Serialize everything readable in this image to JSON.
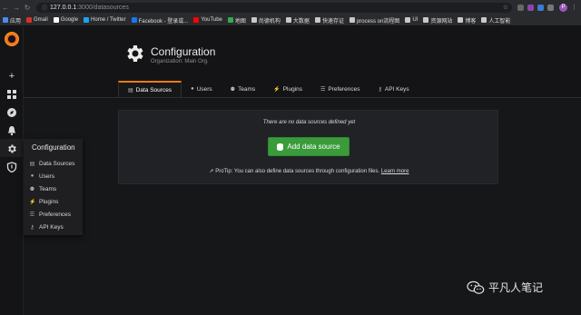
{
  "browser": {
    "url_host": "127.0.0.1",
    "url_path": ":3000/datasources",
    "profile_initial": "P",
    "bookmarks": [
      {
        "label": "应用",
        "color": "#4c8bf5"
      },
      {
        "label": "Gmail",
        "color": "#d93025"
      },
      {
        "label": "Google",
        "color": "#ffffff"
      },
      {
        "label": "Home / Twitter",
        "color": "#1da1f2"
      },
      {
        "label": "Facebook - 登录或...",
        "color": "#1877f2"
      },
      {
        "label": "YouTube",
        "color": "#ff0000"
      },
      {
        "label": "地图",
        "color": "#34a853"
      },
      {
        "label": "尚德机构",
        "color": "#c8c8c8"
      },
      {
        "label": "大数据",
        "color": "#c8c8c8"
      },
      {
        "label": "快速存证",
        "color": "#c8c8c8"
      },
      {
        "label": "process on流程图",
        "color": "#c8c8c8"
      },
      {
        "label": "UI",
        "color": "#c8c8c8"
      },
      {
        "label": "资源网站",
        "color": "#c8c8c8"
      },
      {
        "label": "博客",
        "color": "#c8c8c8"
      },
      {
        "label": "人工智能",
        "color": "#c8c8c8"
      }
    ]
  },
  "sidebar": {
    "icons": [
      "plus-icon",
      "dashboards-icon",
      "explore-icon",
      "alerting-icon",
      "configuration-icon",
      "shield-icon"
    ]
  },
  "flyout": {
    "title": "Configuration",
    "items": [
      {
        "label": "Data Sources",
        "icon": "database-icon"
      },
      {
        "label": "Users",
        "icon": "user-icon"
      },
      {
        "label": "Teams",
        "icon": "users-icon"
      },
      {
        "label": "Plugins",
        "icon": "plug-icon"
      },
      {
        "label": "Preferences",
        "icon": "sliders-icon"
      },
      {
        "label": "API Keys",
        "icon": "key-icon"
      }
    ]
  },
  "header": {
    "title": "Configuration",
    "subtitle": "Organization: Main Org."
  },
  "tabs": [
    {
      "label": "Data Sources",
      "icon": "database-icon",
      "active": true
    },
    {
      "label": "Users",
      "icon": "user-icon",
      "active": false
    },
    {
      "label": "Teams",
      "icon": "users-icon",
      "active": false
    },
    {
      "label": "Plugins",
      "icon": "plug-icon",
      "active": false
    },
    {
      "label": "Preferences",
      "icon": "sliders-icon",
      "active": false
    },
    {
      "label": "API Keys",
      "icon": "key-icon",
      "active": false
    }
  ],
  "empty": {
    "message": "There are no data sources defined yet",
    "button_label": "Add data source",
    "protip_text": "ProTip: You can also define data sources through configuration files.",
    "protip_link": "Learn more"
  },
  "watermark": {
    "text": "平凡人笔记"
  },
  "colors": {
    "accent": "#eb7b18",
    "success": "#3a9b3a",
    "background": "#161719"
  }
}
